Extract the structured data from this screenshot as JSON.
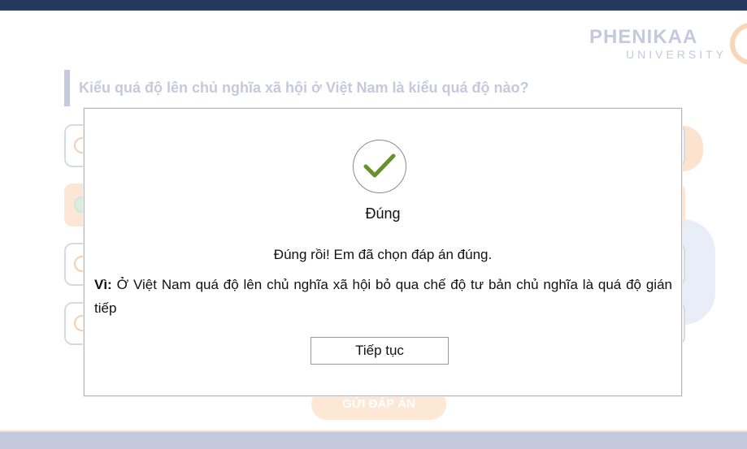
{
  "header": {
    "logo_name": "PHENIKAA",
    "logo_sub": "UNIVERSITY"
  },
  "question": {
    "text": "Kiểu quá độ lên chủ nghĩa xã hội ở Việt Nam là kiểu quá độ nào?"
  },
  "options": [
    {
      "selected": false
    },
    {
      "selected": true
    },
    {
      "selected": false
    },
    {
      "selected": false
    }
  ],
  "submit_label": "GỬI ĐÁP ÁN",
  "modal": {
    "status": "Đúng",
    "feedback": "Đúng rồi! Em đã chọn đáp án đúng.",
    "explanation_label": "Vì:",
    "explanation_text": " Ở Việt Nam quá độ lên chủ nghĩa xã hội bỏ qua chế độ tư bản chủ nghĩa là quá độ gián tiếp",
    "continue_label": "Tiếp tục"
  },
  "colors": {
    "topbar": "#233a5e",
    "check": "#6b8e2f",
    "accent": "#f5cfb2"
  }
}
